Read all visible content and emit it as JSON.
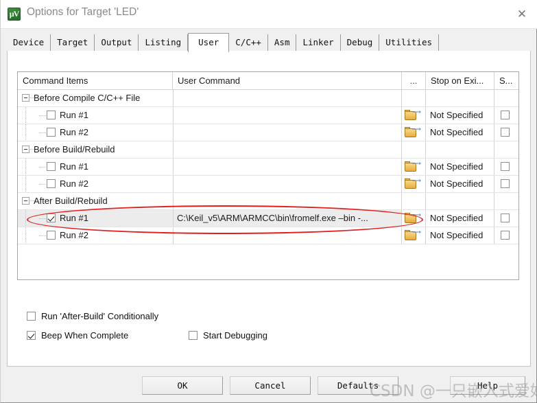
{
  "window": {
    "title": "Options for Target 'LED'",
    "icon": "uvision-logo-icon",
    "close_label": "✕"
  },
  "tabs": [
    {
      "label": "Device",
      "active": false
    },
    {
      "label": "Target",
      "active": false
    },
    {
      "label": "Output",
      "active": false
    },
    {
      "label": "Listing",
      "active": false
    },
    {
      "label": "User",
      "active": true
    },
    {
      "label": "C/C++",
      "active": false
    },
    {
      "label": "Asm",
      "active": false
    },
    {
      "label": "Linker",
      "active": false
    },
    {
      "label": "Debug",
      "active": false
    },
    {
      "label": "Utilities",
      "active": false
    }
  ],
  "table": {
    "headers": {
      "command_items": "Command Items",
      "user_command": "User Command",
      "dots": "...",
      "stop_on_exit": "Stop on Exi...",
      "s": "S..."
    },
    "rows": [
      {
        "type": "group",
        "label": "Before Compile C/C++ File",
        "expanded": true,
        "command": "",
        "stop": "",
        "has_folder": false,
        "has_s": false,
        "checked": false,
        "selected": false
      },
      {
        "type": "child",
        "label": "Run #1",
        "checked": false,
        "command": "",
        "stop": "Not Specified",
        "has_folder": true,
        "has_s": true,
        "s_checked": false,
        "selected": false
      },
      {
        "type": "child",
        "label": "Run #2",
        "checked": false,
        "command": "",
        "stop": "Not Specified",
        "has_folder": true,
        "has_s": true,
        "s_checked": false,
        "selected": false
      },
      {
        "type": "group",
        "label": "Before Build/Rebuild",
        "expanded": true,
        "command": "",
        "stop": "",
        "has_folder": false,
        "has_s": false,
        "checked": false,
        "selected": false
      },
      {
        "type": "child",
        "label": "Run #1",
        "checked": false,
        "command": "",
        "stop": "Not Specified",
        "has_folder": true,
        "has_s": true,
        "s_checked": false,
        "selected": false
      },
      {
        "type": "child",
        "label": "Run #2",
        "checked": false,
        "command": "",
        "stop": "Not Specified",
        "has_folder": true,
        "has_s": true,
        "s_checked": false,
        "selected": false
      },
      {
        "type": "group",
        "label": "After Build/Rebuild",
        "expanded": true,
        "command": "",
        "stop": "",
        "has_folder": false,
        "has_s": false,
        "checked": false,
        "selected": false
      },
      {
        "type": "child",
        "label": "Run #1",
        "checked": true,
        "command": "C:\\Keil_v5\\ARM\\ARMCC\\bin\\fromelf.exe –bin -...",
        "stop": "Not Specified",
        "has_folder": true,
        "has_s": true,
        "s_checked": false,
        "selected": true
      },
      {
        "type": "child",
        "label": "Run #2",
        "checked": false,
        "command": "",
        "stop": "Not Specified",
        "has_folder": true,
        "has_s": true,
        "s_checked": false,
        "selected": false
      }
    ]
  },
  "options": [
    {
      "label": "Run 'After-Build' Conditionally",
      "checked": false
    },
    {
      "label": "Beep When Complete",
      "checked": true
    },
    {
      "label": "Start Debugging",
      "checked": false
    }
  ],
  "buttons": [
    {
      "label": "OK"
    },
    {
      "label": "Cancel"
    },
    {
      "label": "Defaults"
    },
    {
      "label": "Help"
    }
  ],
  "annotations": {
    "watermark": "CSDN @一只嵌入式爱好者",
    "highlight_color": "#e02020"
  }
}
